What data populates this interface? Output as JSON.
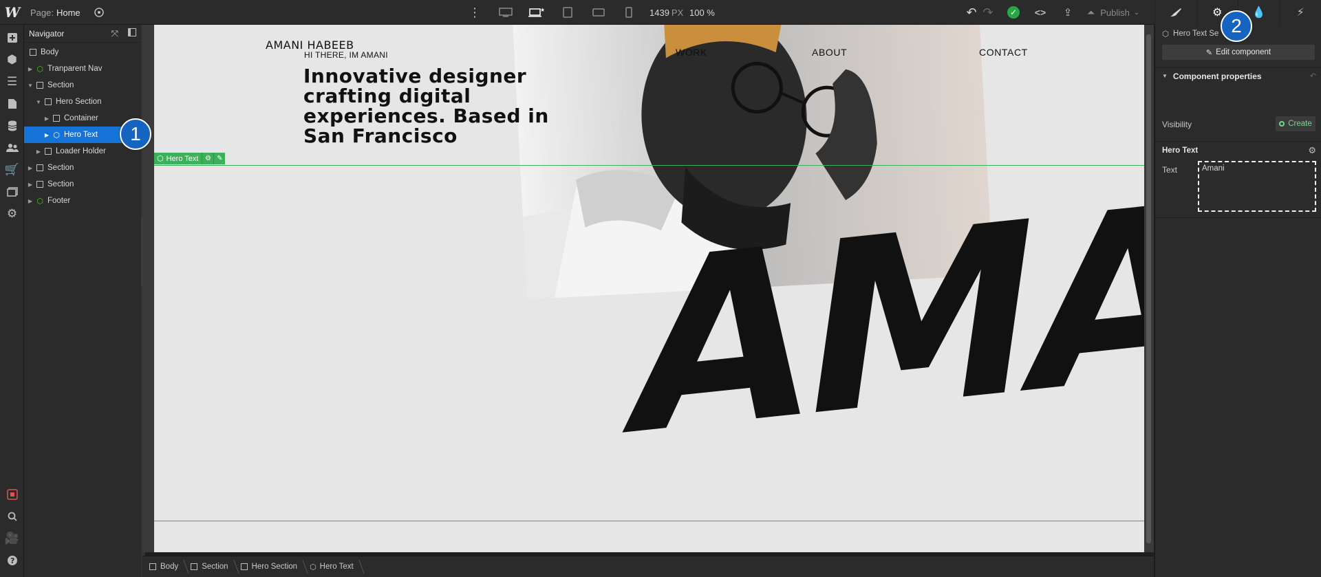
{
  "app": {
    "logo": "W",
    "page_prefix": "Page:",
    "page_name": "Home",
    "width_value": "1439",
    "width_unit": "PX",
    "zoom": "100 %",
    "publish_label": "Publish",
    "accent_color": "#1573d8",
    "selection_color": "#3bb25a"
  },
  "navigator": {
    "title": "Navigator",
    "items": [
      {
        "label": "Body",
        "type": "box"
      },
      {
        "label": "Tranparent Nav",
        "type": "component"
      },
      {
        "label": "Section",
        "type": "box"
      },
      {
        "label": "Hero Section",
        "type": "box"
      },
      {
        "label": "Container",
        "type": "box"
      },
      {
        "label": "Hero Text",
        "type": "component",
        "selected": true
      },
      {
        "label": "Loader Holder",
        "type": "box"
      },
      {
        "label": "Section",
        "type": "box"
      },
      {
        "label": "Section",
        "type": "box"
      },
      {
        "label": "Footer",
        "type": "component"
      }
    ]
  },
  "canvas": {
    "logo_text": "AMANI HABEEB",
    "greeting": "HI THERE, IM AMANI",
    "headline": "Innovative designer crafting  digital experiences. Based in San Francisco",
    "nav": [
      "WORK",
      "ABOUT",
      "CONTACT"
    ],
    "big_text": "AMA",
    "selection_label": "Hero Text"
  },
  "breadcrumbs": [
    "Body",
    "Section",
    "Hero Section",
    "Hero Text"
  ],
  "right_panel": {
    "crumb": "Hero Text Se",
    "edit_component": "Edit component",
    "section_title": "Component properties",
    "visibility_label": "Visibility",
    "create_label": "Create",
    "hero_text_title": "Hero Text",
    "text_label": "Text",
    "text_value": "Amani"
  },
  "callouts": [
    "1",
    "2"
  ]
}
